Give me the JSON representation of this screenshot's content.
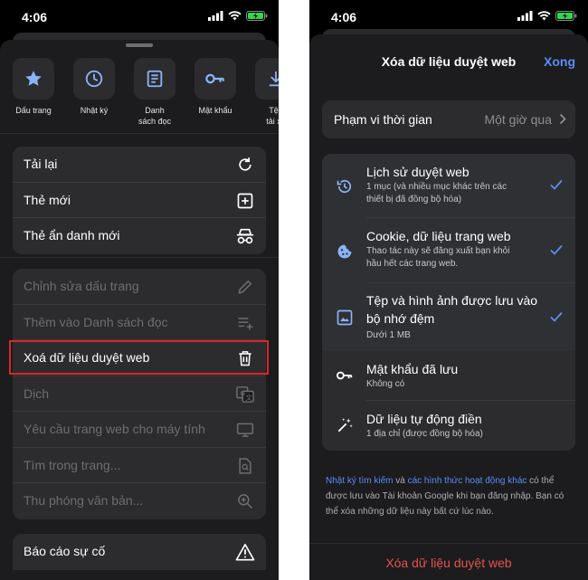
{
  "status_bar": {
    "time": "4:06"
  },
  "menu": {
    "quick_actions": [
      {
        "label": "Dấu trang",
        "icon": "star-icon"
      },
      {
        "label": "Nhật ký",
        "icon": "clock-icon"
      },
      {
        "label": "Danh\nsách đọc",
        "icon": "reading-list-icon"
      },
      {
        "label": "Mật khẩu",
        "icon": "key-icon"
      },
      {
        "label": "Tệp\ntải xu",
        "icon": "download-icon"
      }
    ],
    "group1": [
      {
        "label": "Tải lại",
        "icon": "reload-icon"
      },
      {
        "label": "Thẻ mới",
        "icon": "new-tab-icon"
      },
      {
        "label": "Thẻ ẩn danh mới",
        "icon": "incognito-icon"
      }
    ],
    "group2": [
      {
        "label": "Chỉnh sửa dấu trang",
        "icon": "pencil-icon",
        "enabled": false
      },
      {
        "label": "Thêm vào Danh sách đọc",
        "icon": "add-to-list-icon",
        "enabled": false
      },
      {
        "label": "Xoá dữ liệu duyệt web",
        "icon": "trash-icon",
        "enabled": true
      },
      {
        "label": "Dịch",
        "icon": "translate-icon",
        "enabled": false
      },
      {
        "label": "Yêu cầu trang web cho máy tính",
        "icon": "desktop-icon",
        "enabled": false
      },
      {
        "label": "Tìm trong trang...",
        "icon": "find-in-page-icon",
        "enabled": false
      },
      {
        "label": "Thu phóng văn bản...",
        "icon": "zoom-icon",
        "enabled": false
      }
    ],
    "group3": [
      {
        "label": "Báo cáo sự cố",
        "icon": "warning-icon"
      }
    ]
  },
  "clear_data": {
    "title": "Xóa dữ liệu duyệt web",
    "done_label": "Xong",
    "time_range": {
      "label": "Phạm vi thời gian",
      "value": "Một giờ qua"
    },
    "items": [
      {
        "title": "Lịch sử duyệt web",
        "subtitle": "1 mục (và nhiều mục khác trên các\nthiết bị đã đồng bộ hóa)",
        "checked": true,
        "icon": "history-icon"
      },
      {
        "title": "Cookie, dữ liệu trang web",
        "subtitle": "Thao tác này sẽ đăng xuất bạn khỏi\nhầu hết các trang web.",
        "checked": true,
        "icon": "cookie-icon"
      },
      {
        "title": "Tệp và hình ảnh được lưu vào\nbộ nhớ đệm",
        "subtitle": "Dưới 1 MB",
        "checked": true,
        "icon": "image-icon"
      },
      {
        "title": "Mật khẩu đã lưu",
        "subtitle": "Không có",
        "checked": false,
        "icon": "key-icon"
      },
      {
        "title": "Dữ liệu tự động điền",
        "subtitle": "1 địa chỉ (được đồng bộ hóa)",
        "checked": false,
        "icon": "magic-wand-icon"
      }
    ],
    "footnote": {
      "link1": "Nhật ký tìm kiếm",
      "mid": " và ",
      "link2": "các hình thức hoạt động khác",
      "rest": " có thể được lưu vào Tài khoản Google khi bạn đăng nhập. Bạn có thể xóa những dữ liệu này bất cứ lúc nào."
    },
    "clear_button": "Xóa dữ liệu duyệt web"
  },
  "colors": {
    "accent": "#5a8cf5",
    "destructive": "#e5534b",
    "highlight_box": "#d9262b"
  }
}
